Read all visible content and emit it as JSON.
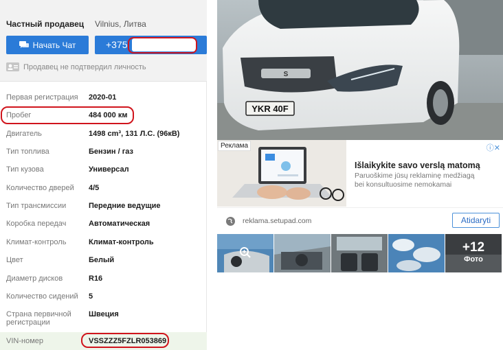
{
  "seller": {
    "type": "Частный продавец",
    "location": "Vilnius, Литва",
    "chat_button": "Начать Чат",
    "phone_prefix": "+375",
    "verification_note": "Продавец не подтвердил личность"
  },
  "specs": [
    {
      "label": "Первая регистрация",
      "value": "2020-01"
    },
    {
      "label": "Пробег",
      "value": "484 000 км"
    },
    {
      "label": "Двигатель",
      "value": "1498 cm³, 131 Л.С. (96кВ)"
    },
    {
      "label": "Тип топлива",
      "value": "Бензин / газ"
    },
    {
      "label": "Тип кузова",
      "value": "Универсал"
    },
    {
      "label": "Количество дверей",
      "value": "4/5"
    },
    {
      "label": "Тип трансмиссии",
      "value": "Передние ведущие"
    },
    {
      "label": "Коробка передач",
      "value": "Автоматическая"
    },
    {
      "label": "Климат-контроль",
      "value": "Климат-контроль"
    },
    {
      "label": "Цвет",
      "value": "Белый"
    },
    {
      "label": "Диаметр дисков",
      "value": "R16"
    },
    {
      "label": "Количество сидений",
      "value": "5"
    },
    {
      "label": "Страна первичной регистрации",
      "value": "Швеция"
    },
    {
      "label": "VIN-номер",
      "value": "VSSZZZ5FZLR053869"
    }
  ],
  "photo": {
    "plate": "YKR 40F"
  },
  "ad": {
    "tag": "Реклама",
    "title": "Išlaikykite savo verslą matomą",
    "description": "Paruoškime jūsų reklaminę medžiagą bei konsultuosime nemokamai",
    "domain": "reklama.setupad.com",
    "cta": "Atidaryti",
    "close_icon": "ⓘ✕"
  },
  "gallery": {
    "more_count": "+12",
    "more_label": "Фото"
  },
  "colors": {
    "accent_blue": "#2b7bd8",
    "highlight_red": "#d0141c",
    "vin_row_bg": "#eef5ea"
  }
}
